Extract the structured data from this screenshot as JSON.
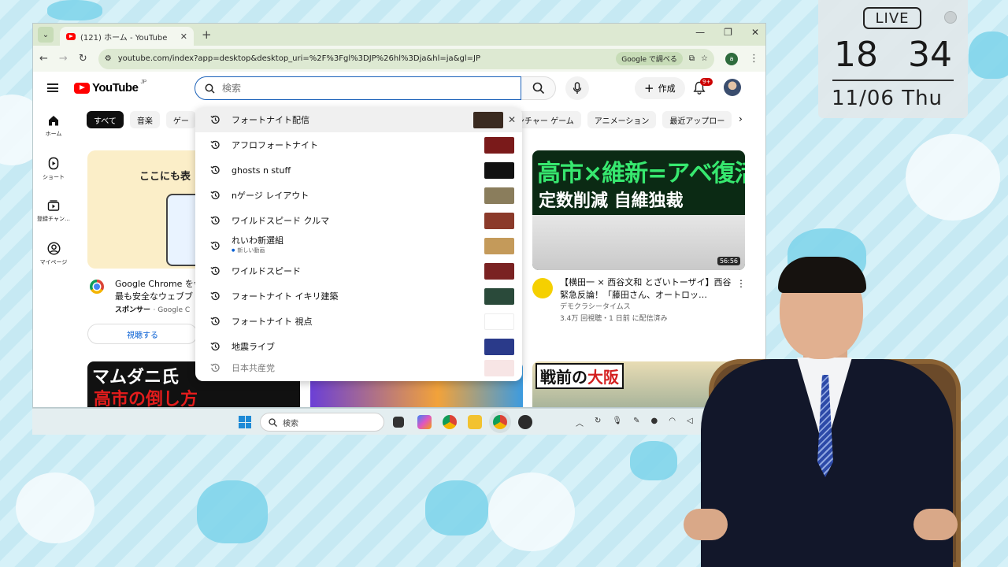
{
  "browser": {
    "tab_title": "(121) ホーム - YouTube",
    "url": "youtube.com/index?app=desktop&desktop_uri=%2F%3Fgl%3DJP%26hl%3Dja&hl=ja&gl=JP",
    "google_search_label": "Google で調べる",
    "account_initial": "a"
  },
  "youtube": {
    "logo_text": "YouTube",
    "logo_region": "JP",
    "search_placeholder": "検索",
    "create_label": "作成",
    "notification_count": "9+",
    "sidebar": [
      {
        "label": "ホーム",
        "icon": "home-icon"
      },
      {
        "label": "ショート",
        "icon": "shorts-icon"
      },
      {
        "label": "登録チャン…",
        "icon": "subscriptions-icon"
      },
      {
        "label": "マイページ",
        "icon": "user-icon"
      }
    ],
    "chips_left": [
      "すべて",
      "音楽",
      "ゲー"
    ],
    "chips_right": [
      "ンチャー ゲーム",
      "アニメーション",
      "最近アップロー"
    ],
    "suggestions": [
      {
        "text": "フォートナイト配信",
        "thumb": "#3a2a20"
      },
      {
        "text": "アフロフォートナイト",
        "thumb": "#7a1a1a"
      },
      {
        "text": "ghosts n stuff",
        "thumb": "#111111"
      },
      {
        "text": "nゲージ レイアウト",
        "thumb": "#8a7d5c"
      },
      {
        "text": "ワイルドスピード クルマ",
        "thumb": "#8b3a2a"
      },
      {
        "text": "れいわ新選組",
        "sub": "新しい動画",
        "thumb": "#c49a5a"
      },
      {
        "text": "ワイルドスピード",
        "thumb": "#7a2222"
      },
      {
        "text": "フォートナイト イキリ建築",
        "thumb": "#2a4a3a"
      },
      {
        "text": "フォートナイト 視点",
        "thumb": "#ffffff"
      },
      {
        "text": "地震ライブ",
        "thumb": "#2a3a8a"
      },
      {
        "text": "日本共産党",
        "thumb": "#f0d0d0"
      }
    ],
    "ad": {
      "banner_text": "ここにも表",
      "title_line1": "Google Chrome を今",
      "title_line2": "最も安全なウェブブ",
      "sponsor": "スポンサー",
      "sponsor_source": "· Google C",
      "watch_button": "視聴する"
    },
    "video_right": {
      "thumb_line1": "高市×維新=アベ復活",
      "thumb_line2": "定数削減 自維独裁",
      "duration": "56:56",
      "title": "【横田一 × 西谷文和 とざいトーザイ】西谷緊急反論！「藤田さん、オートロッ…",
      "channel": "デモクラシータイムス",
      "stats": "3.4万 回視聴・1 日前 に配信済み"
    },
    "bottom_thumbs": {
      "left_line1": "マムダニ氏",
      "left_line2": "高市の倒し方",
      "right_text_black": "戦前の",
      "right_text_red": "大阪"
    }
  },
  "taskbar": {
    "search_placeholder": "検索"
  },
  "clock": {
    "live_label": "LIVE",
    "hour": "18",
    "minute": "34",
    "date": "11/06 Thu"
  }
}
